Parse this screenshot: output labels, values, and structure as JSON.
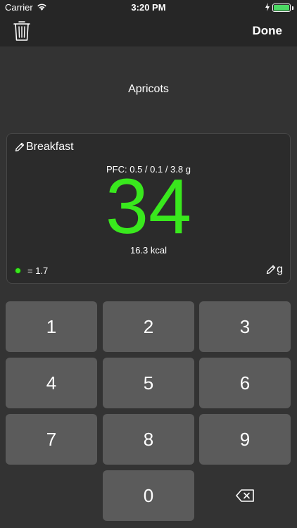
{
  "status_bar": {
    "carrier": "Carrier",
    "time": "3:20 PM"
  },
  "nav": {
    "done_label": "Done"
  },
  "food": {
    "name": "Apricots"
  },
  "card": {
    "meal_label": "Breakfast",
    "pfc": "PFC: 0.5 / 0.1 / 3.8 g",
    "amount": "34",
    "kcal": "16.3 kcal",
    "ratio": "= 1.7",
    "unit": "g"
  },
  "colors": {
    "accent": "#39e81d",
    "background": "#333333",
    "key": "#5b5b5b"
  },
  "keypad": {
    "keys": [
      "1",
      "2",
      "3",
      "4",
      "5",
      "6",
      "7",
      "8",
      "9",
      "0"
    ]
  }
}
